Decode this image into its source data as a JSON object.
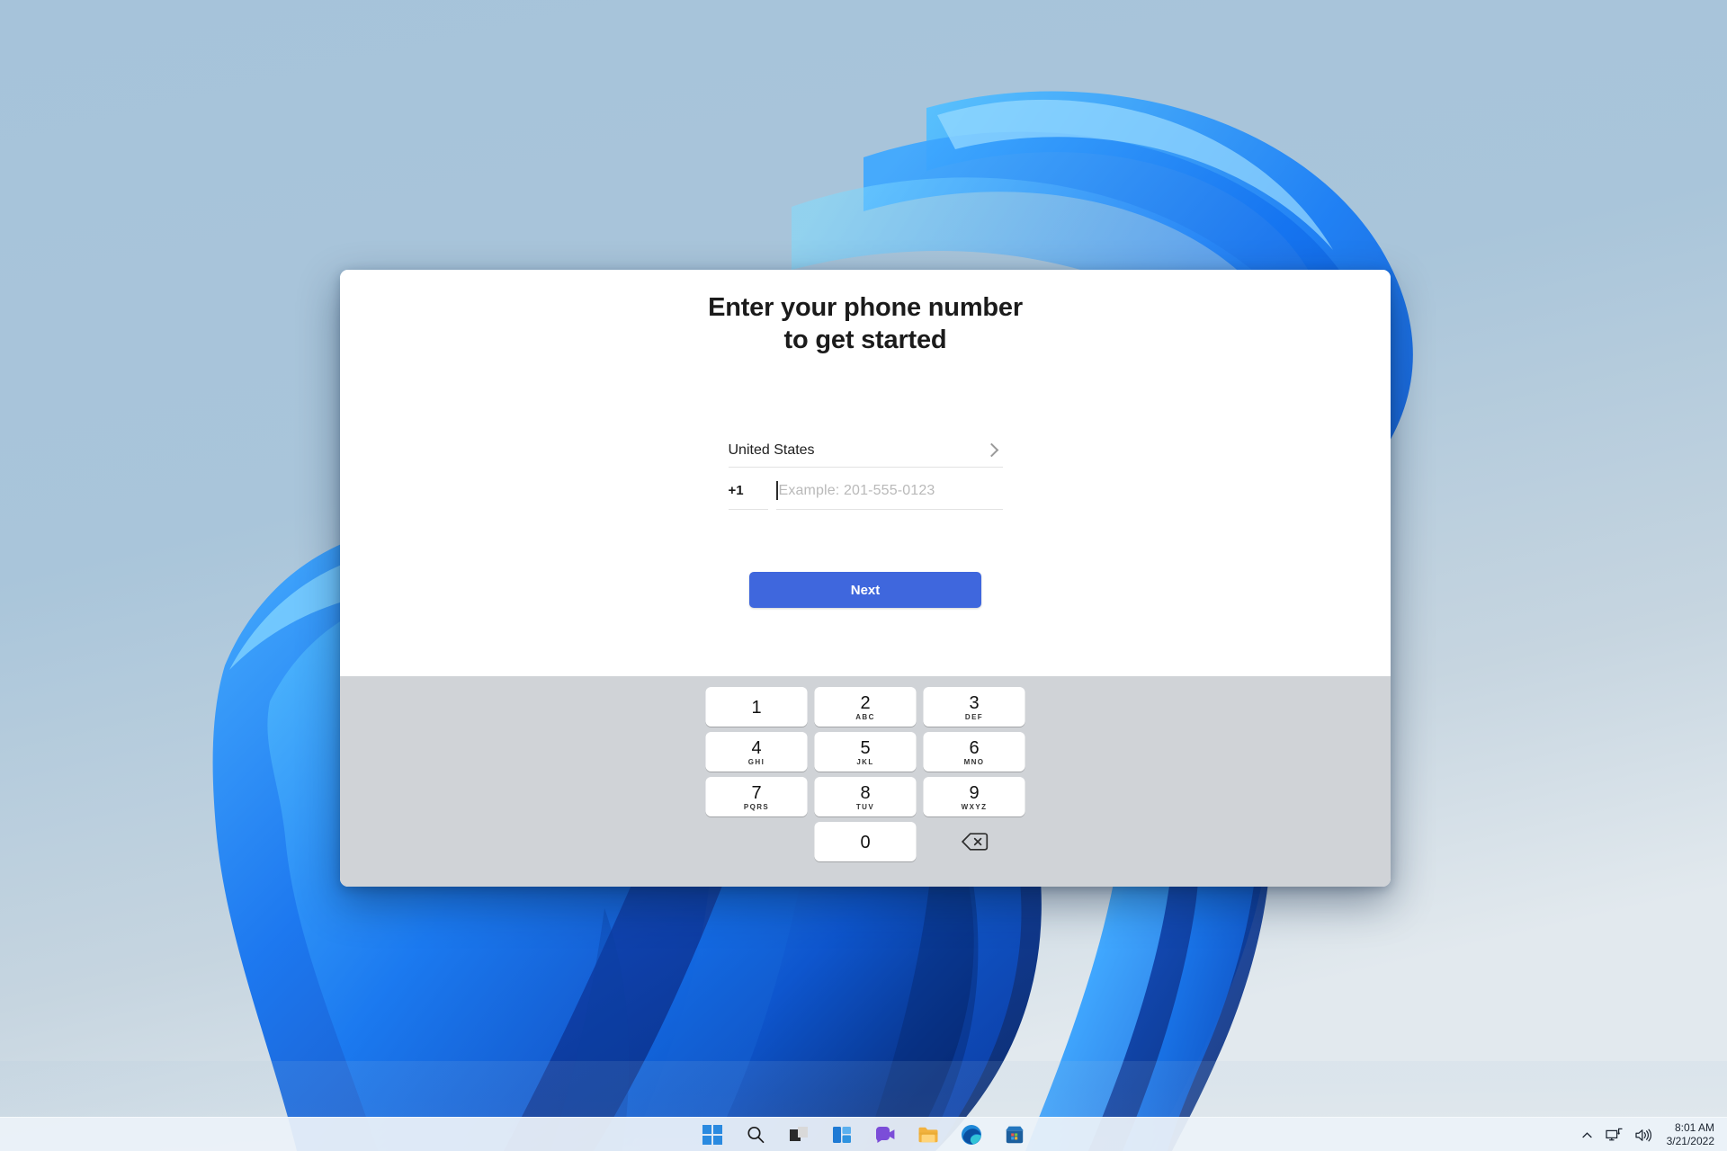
{
  "desktop": {
    "wallpaper_name": "windows-bloom-wallpaper",
    "background_color": "#a3c1d8"
  },
  "dialog": {
    "title": "Enter your phone number\nto get started",
    "title_line1": "Enter your phone number",
    "title_line2": "to get started",
    "country": {
      "label": "United States",
      "chevron_icon": "chevron-right-icon"
    },
    "phone": {
      "country_code": "+1",
      "value": "",
      "placeholder": "Example: 201-555-0123"
    },
    "next_button": {
      "label": "Next",
      "color": "#3f67dd"
    },
    "keypad": {
      "background_color": "#d0d3d7",
      "keys": [
        {
          "digit": "1",
          "letters": ""
        },
        {
          "digit": "2",
          "letters": "ABC"
        },
        {
          "digit": "3",
          "letters": "DEF"
        },
        {
          "digit": "4",
          "letters": "GHI"
        },
        {
          "digit": "5",
          "letters": "JKL"
        },
        {
          "digit": "6",
          "letters": "MNO"
        },
        {
          "digit": "7",
          "letters": "PQRS"
        },
        {
          "digit": "8",
          "letters": "TUV"
        },
        {
          "digit": "9",
          "letters": "WXYZ"
        },
        {
          "digit": "0",
          "letters": ""
        }
      ],
      "backspace_icon": "backspace-icon"
    }
  },
  "taskbar": {
    "apps": [
      {
        "name": "start-button",
        "icon": "windows-logo-icon"
      },
      {
        "name": "search-button",
        "icon": "search-icon"
      },
      {
        "name": "task-view-button",
        "icon": "task-view-icon"
      },
      {
        "name": "widgets-button",
        "icon": "widgets-icon"
      },
      {
        "name": "chat-button",
        "icon": "chat-camera-icon"
      },
      {
        "name": "file-explorer-button",
        "icon": "folder-icon"
      },
      {
        "name": "edge-button",
        "icon": "edge-browser-icon"
      },
      {
        "name": "store-button",
        "icon": "microsoft-store-icon"
      }
    ],
    "tray": {
      "show_hidden_icons": "chevron-up-icon",
      "network_icon": "network-monitor-icon",
      "volume_icon": "speaker-icon",
      "time": "8:01 AM",
      "date": "3/21/2022"
    }
  }
}
